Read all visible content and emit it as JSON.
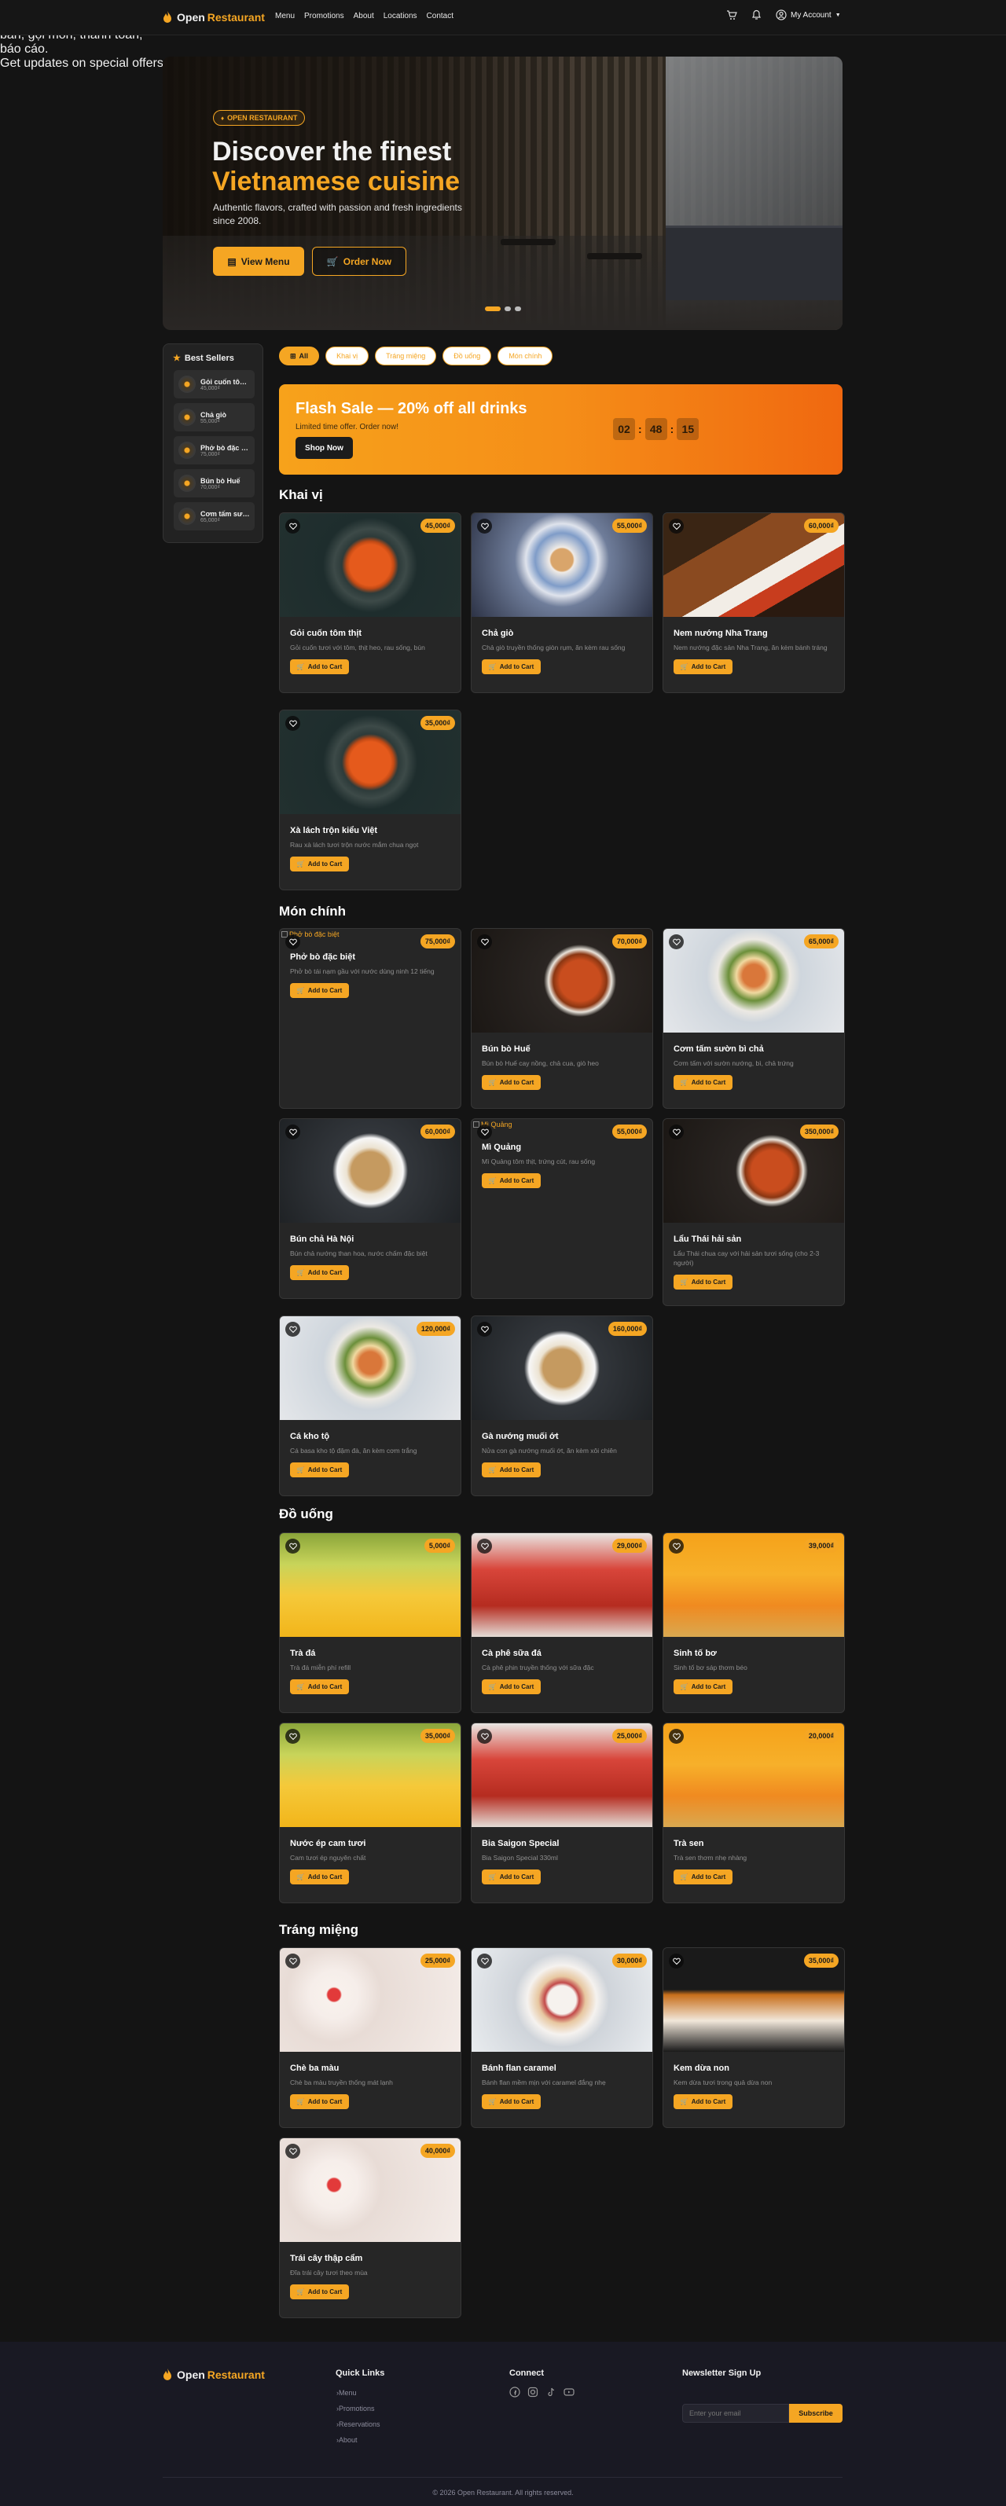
{
  "brand": {
    "name_part1": "Open",
    "name_part2": "Restaurant",
    "accent": "#f5a623"
  },
  "nav": {
    "links": [
      "Menu",
      "Promotions",
      "About",
      "Locations",
      "Contact"
    ],
    "account_label": "My Account",
    "icons": [
      "cart-icon",
      "bell-icon",
      "user-icon",
      "chevron-down-icon"
    ]
  },
  "hero": {
    "badge": "OPEN RESTAURANT",
    "title_line1": "Discover the finest",
    "title_line2": "Vietnamese cuisine",
    "description": "Authentic flavors, crafted with passion and fresh ingredients since 2008.",
    "btn_menu": "View Menu",
    "btn_order": "Order Now",
    "slides": 3,
    "active_slide": 1
  },
  "sidebar": {
    "title": "Best Sellers",
    "items": [
      {
        "name": "Gỏi cuốn tôm thịt",
        "price": "45,000₫"
      },
      {
        "name": "Chả giò",
        "price": "55,000₫"
      },
      {
        "name": "Phở bò đặc biệt",
        "price": "75,000₫"
      },
      {
        "name": "Bún bò Huế",
        "price": "70,000₫"
      },
      {
        "name": "Cơm tấm sườn bì chả",
        "price": "65,000₫"
      }
    ]
  },
  "filters": [
    "All",
    "Khai vị",
    "Tráng miệng",
    "Đồ uống",
    "Món chính"
  ],
  "flash": {
    "title": "Flash Sale — 20% off all drinks",
    "subtitle": "Limited time offer. Order now!",
    "button": "Shop Now",
    "timer": {
      "h": "02",
      "m": "48",
      "s": "15"
    }
  },
  "add_label": "Add to Cart",
  "sections": [
    {
      "title": "Khai vị",
      "items": [
        {
          "name": "Gỏi cuốn tôm thịt",
          "desc": "Gỏi cuốn tươi với tôm, thịt heo, rau sống, bún",
          "price": "45,000₫"
        },
        {
          "name": "Chả giò",
          "desc": "Chả giò truyền thống giòn rụm, ăn kèm rau sống",
          "price": "55,000₫"
        },
        {
          "name": "Nem nướng Nha Trang",
          "desc": "Nem nướng đặc sản Nha Trang, ăn kèm bánh tráng",
          "price": "60,000₫"
        },
        {
          "name": "Xà lách trộn kiểu Việt",
          "desc": "Rau xà lách tươi trộn nước mắm chua ngọt",
          "price": "35,000₫"
        }
      ]
    },
    {
      "title": "Món chính",
      "items": [
        {
          "name": "Phở bò đặc biệt",
          "desc": "Phở bò tái nạm gầu với nước dùng ninh 12 tiếng",
          "price": "75,000₫",
          "broken_alt": "Phở bò đặc biệt"
        },
        {
          "name": "Bún bò Huế",
          "desc": "Bún bò Huế cay nồng, chả cua, giò heo",
          "price": "70,000₫"
        },
        {
          "name": "Cơm tấm sườn bì chả",
          "desc": "Cơm tấm với sườn nướng, bì, chả trứng",
          "price": "65,000₫"
        },
        {
          "name": "Bún chả Hà Nội",
          "desc": "Bún chả nướng than hoa, nước chấm đặc biệt",
          "price": "60,000₫"
        },
        {
          "name": "Mì Quảng",
          "desc": "Mì Quảng tôm thịt, trứng cút, rau sống",
          "price": "55,000₫",
          "broken_alt": "Mì Quảng"
        },
        {
          "name": "Lẩu Thái hải sản",
          "desc": "Lẩu Thái chua cay với hải sản tươi sống (cho 2-3 người)",
          "price": "350,000₫"
        },
        {
          "name": "Cá kho tộ",
          "desc": "Cá basa kho tộ đậm đà, ăn kèm cơm trắng",
          "price": "120,000₫"
        },
        {
          "name": "Gà nướng muối ớt",
          "desc": "Nửa con gà nướng muối ớt, ăn kèm xôi chiên",
          "price": "160,000₫"
        }
      ]
    },
    {
      "title": "Đồ uống",
      "items": [
        {
          "name": "Trà đá",
          "desc": "Trà đá miễn phí refill",
          "price": "5,000₫"
        },
        {
          "name": "Cà phê sữa đá",
          "desc": "Cà phê phin truyền thống với sữa đặc",
          "price": "29,000₫"
        },
        {
          "name": "Sinh tố bơ",
          "desc": "Sinh tố bơ sáp thơm béo",
          "price": "39,000₫"
        },
        {
          "name": "Nước ép cam tươi",
          "desc": "Cam tươi ép nguyên chất",
          "price": "35,000₫"
        },
        {
          "name": "Bia Saigon Special",
          "desc": "Bia Saigon Special 330ml",
          "price": "25,000₫"
        },
        {
          "name": "Trà sen",
          "desc": "Trà sen thơm nhẹ nhàng",
          "price": "20,000₫"
        }
      ]
    },
    {
      "title": "Tráng miệng",
      "items": [
        {
          "name": "Chè ba màu",
          "desc": "Chè ba màu truyền thống mát lạnh",
          "price": "25,000₫"
        },
        {
          "name": "Bánh flan caramel",
          "desc": "Bánh flan mềm mịn với caramel đắng nhẹ",
          "price": "30,000₫"
        },
        {
          "name": "Kem dừa non",
          "desc": "Kem dừa tươi trong quả dừa non",
          "price": "35,000₫"
        },
        {
          "name": "Trái cây thập cẩm",
          "desc": "Đĩa trái cây tươi theo mùa",
          "price": "40,000₫"
        }
      ]
    }
  ],
  "footer": {
    "about": "Hệ thống quản lý nhà hàng thông minh — đặt bàn, gọi món, thanh toán, báo cáo.",
    "quick_title": "Quick Links",
    "quick_links": [
      "Menu",
      "Promotions",
      "Reservations",
      "About"
    ],
    "connect_title": "Connect",
    "social_icons": [
      "facebook-icon",
      "instagram-icon",
      "tiktok-icon",
      "youtube-icon"
    ],
    "newsletter_title": "Newsletter Sign Up",
    "newsletter_text": "Get updates on special offers and new dishes.",
    "newsletter_placeholder": "Enter your email",
    "newsletter_button": "Subscribe",
    "copyright": "© 2026 Open Restaurant. All rights reserved."
  }
}
